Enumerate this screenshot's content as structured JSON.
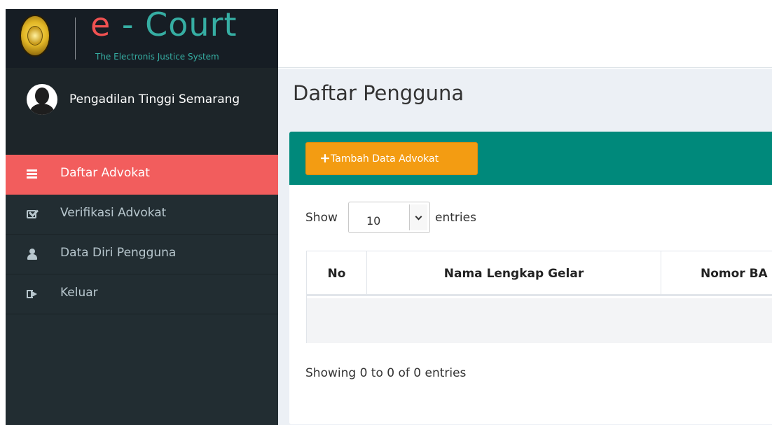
{
  "brand": {
    "title_prefix": "e",
    "title_rest": " - Court",
    "subtitle": "The Electronis Justice System"
  },
  "user": {
    "name": "Pengadilan Tinggi Semarang"
  },
  "menu": {
    "items": [
      {
        "label": "Daftar Advokat",
        "icon": "list-icon",
        "active": true
      },
      {
        "label": "Verifikasi Advokat",
        "icon": "check-square-icon",
        "active": false
      },
      {
        "label": "Data Diri Pengguna",
        "icon": "user-icon",
        "active": false
      },
      {
        "label": "Keluar",
        "icon": "sign-out-icon",
        "active": false
      }
    ]
  },
  "page": {
    "title": "Daftar Pengguna"
  },
  "toolbar": {
    "add_button_icon": "+",
    "add_button_label": "Tambah Data Advokat"
  },
  "table_length": {
    "show_label": "Show",
    "value": "10",
    "entries_label": "entries"
  },
  "table": {
    "columns": [
      "No",
      "Nama Lengkap Gelar",
      "Nomor BA"
    ]
  },
  "table_info": "Showing 0 to 0 of 0 entries",
  "colors": {
    "sidebar_bg": "#222d32",
    "active_menu": "#f25d5d",
    "box_header": "#00897b",
    "add_button": "#f39c12",
    "brand_accent": "#36aea3"
  }
}
